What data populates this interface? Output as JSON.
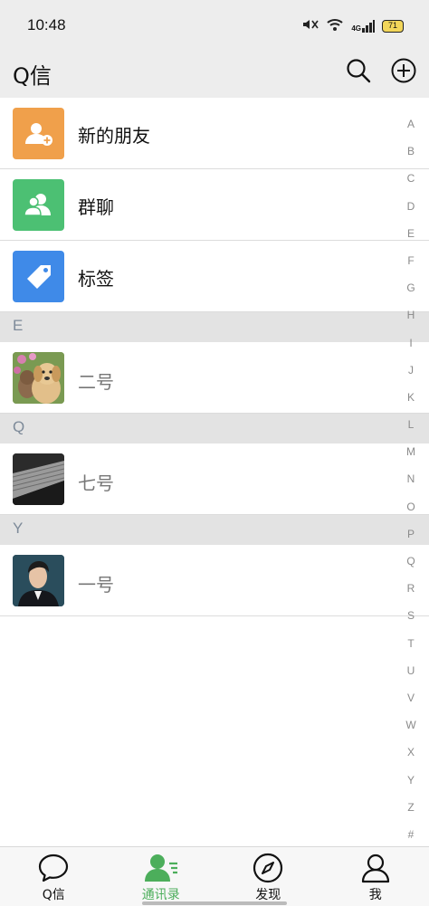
{
  "status": {
    "time": "10:48",
    "battery": "71",
    "signal_label": "4G"
  },
  "header": {
    "title": "Q信"
  },
  "fixed_rows": [
    {
      "label": "新的朋友",
      "icon": "add-friend-icon",
      "color": "#f0a04b"
    },
    {
      "label": "群聊",
      "icon": "group-chat-icon",
      "color": "#4cc073"
    },
    {
      "label": "标签",
      "icon": "tag-icon",
      "color": "#3f8ae8"
    }
  ],
  "sections": [
    {
      "letter": "E",
      "contacts": [
        {
          "name": "二号",
          "avatar": "dog-cat-avatar"
        }
      ]
    },
    {
      "letter": "Q",
      "contacts": [
        {
          "name": "七号",
          "avatar": "keyboard-avatar"
        }
      ]
    },
    {
      "letter": "Y",
      "contacts": [
        {
          "name": "一号",
          "avatar": "man-portrait-avatar"
        }
      ]
    }
  ],
  "alphabet": [
    "A",
    "B",
    "C",
    "D",
    "E",
    "F",
    "G",
    "H",
    "I",
    "J",
    "K",
    "L",
    "M",
    "N",
    "O",
    "P",
    "Q",
    "R",
    "S",
    "T",
    "U",
    "V",
    "W",
    "X",
    "Y",
    "Z",
    "#"
  ],
  "bottom_nav": [
    {
      "label": "Q信",
      "icon": "chat-bubble-icon"
    },
    {
      "label": "通讯录",
      "icon": "contacts-icon",
      "active": true
    },
    {
      "label": "发现",
      "icon": "compass-icon"
    },
    {
      "label": "我",
      "icon": "person-icon"
    }
  ],
  "colors": {
    "accent": "#4cae5b",
    "header_bg": "#ededed",
    "section_bg": "#e3e3e3"
  }
}
